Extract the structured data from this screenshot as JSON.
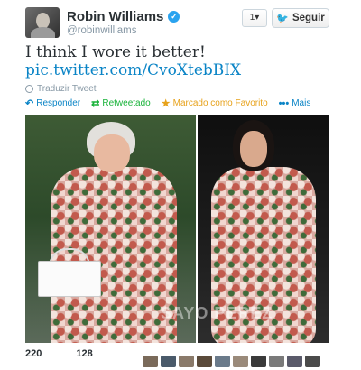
{
  "author": {
    "display_name": "Robin Williams",
    "username": "@robinwilliams",
    "verified_icon": "verified-badge-icon"
  },
  "header_buttons": {
    "follow_menu_label": "1▾",
    "follow_label": "Seguir"
  },
  "tweet": {
    "text": "I think I wore it better!",
    "link": "pic.twitter.com/CvoXtebBIX",
    "translate_label": "Traduzir Tweet"
  },
  "actions": [
    {
      "label": "Responder",
      "icon": "↶",
      "icon_name": "reply-icon"
    },
    {
      "label": "Retweetado",
      "icon": "⇄",
      "icon_name": "retweet-icon"
    },
    {
      "label": "Marcado como Favorito",
      "icon": "★",
      "icon_name": "favorite-star-icon"
    },
    {
      "label": "Mais",
      "icon": "•••",
      "icon_name": "more-dots-icon"
    }
  ],
  "photo": {
    "watermark": "SAYO PEREZ"
  },
  "stats": {
    "retweets": "220",
    "favorites": "128"
  },
  "colors": {
    "link": "#0a84c6",
    "retweet": "#19b33a",
    "favorite": "#e7a21b",
    "verified": "#2aa3ef"
  },
  "avatars": [
    {
      "color": "#7a6a5a"
    },
    {
      "color": "#4a5a6a"
    },
    {
      "color": "#8a7a6a"
    },
    {
      "color": "#5a4a3a"
    },
    {
      "color": "#6a7a8a"
    },
    {
      "color": "#9a8a7a"
    },
    {
      "color": "#3a3a3a"
    },
    {
      "color": "#7a7a7a"
    },
    {
      "color": "#5a5a6a"
    },
    {
      "color": "#4a4a4a"
    }
  ]
}
